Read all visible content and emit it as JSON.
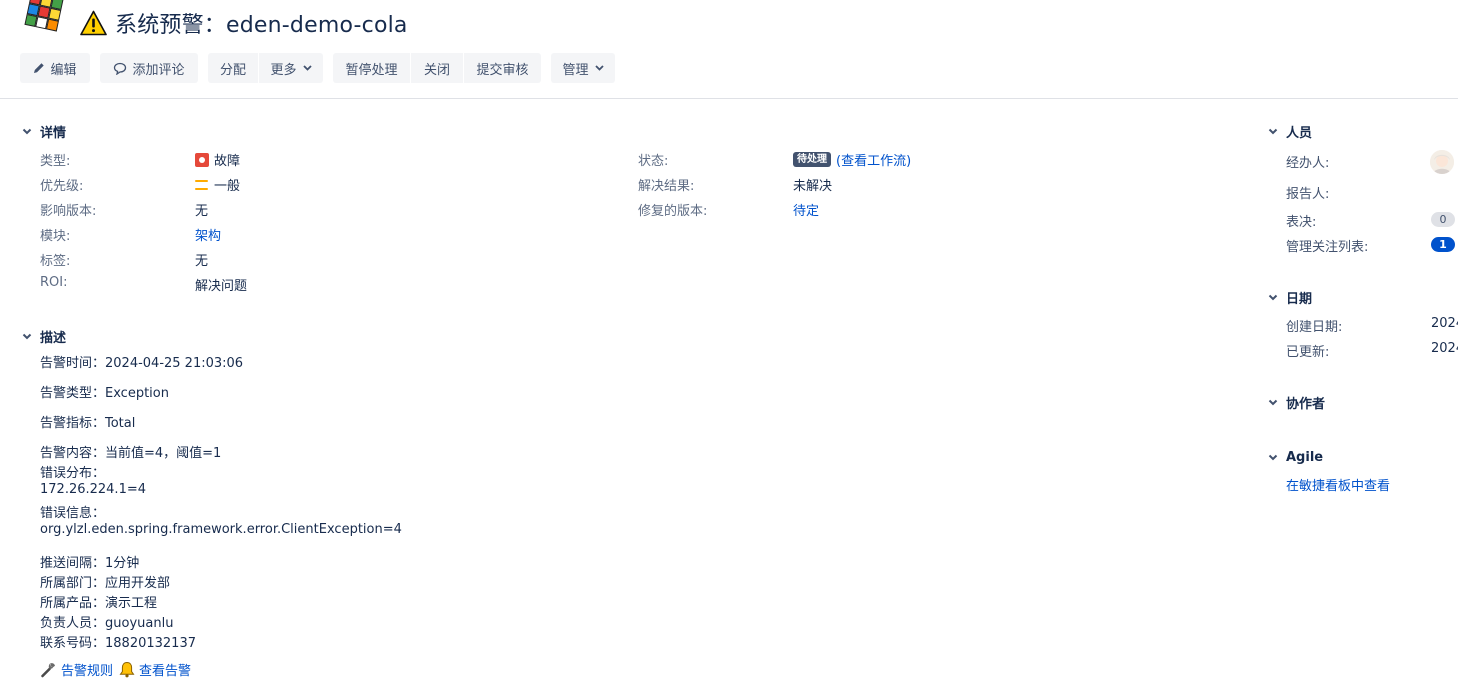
{
  "header": {
    "title": "系统预警：eden-demo-cola"
  },
  "toolbar": {
    "edit": "编辑",
    "add_comment": "添加评论",
    "assign": "分配",
    "more": "更多",
    "pause": "暂停处理",
    "close": "关闭",
    "submit_review": "提交审核",
    "manage": "管理"
  },
  "details": {
    "heading": "详情",
    "left": [
      {
        "label": "类型:",
        "value": "故障"
      },
      {
        "label": "优先级:",
        "value": "一般"
      },
      {
        "label": "影响版本:",
        "value": "无"
      },
      {
        "label": "模块:",
        "value": "架构"
      },
      {
        "label": "标签:",
        "value": "无"
      },
      {
        "label": "ROI:",
        "value": "解决问题"
      }
    ],
    "right": [
      {
        "label": "状态:",
        "value": "待处理",
        "link": "(查看工作流)"
      },
      {
        "label": "解决结果:",
        "value": "未解决"
      },
      {
        "label": "修复的版本:",
        "value": "待定"
      }
    ]
  },
  "description": {
    "heading": "描述",
    "lines": [
      "告警时间：2024-04-25 21:03:06",
      "告警类型：Exception",
      "告警指标：Total",
      "告警内容：当前值=4，阈值=1",
      "错误分布：",
      "172.26.224.1=4",
      "错误信息：",
      "org.ylzl.eden.spring.framework.error.ClientException=4",
      "推送间隔：1分钟",
      "所属部门：应用开发部",
      "所属产品：演示工程",
      "负责人员：guoyuanlu",
      "联系号码：18820132137"
    ],
    "rule_link": "告警规则",
    "view_link": "查看告警"
  },
  "people": {
    "heading": "人员",
    "assignee_label": "经办人:",
    "reporter_label": "报告人:",
    "votes_label": "表决:",
    "votes_count": "0",
    "watchers_label": "管理关注列表:",
    "watchers_count": "1"
  },
  "dates": {
    "heading": "日期",
    "created_label": "创建日期:",
    "created_value": "2024",
    "updated_label": "已更新:",
    "updated_value": "2024"
  },
  "collaborators": {
    "heading": "协作者"
  },
  "agile": {
    "heading": "Agile",
    "link": "在敏捷看板中查看"
  },
  "colors": {
    "link": "#0052cc",
    "bug": "#e5493a",
    "priority": "#ffab00",
    "status_lozenge": "#42526e"
  },
  "icons": [
    "rubik-cube-logo",
    "warning-icon",
    "pencil-icon",
    "comment-icon",
    "chevron-down-icon",
    "bug-icon",
    "priority-medium-icon",
    "wrench-icon",
    "bell-icon",
    "avatar"
  ]
}
